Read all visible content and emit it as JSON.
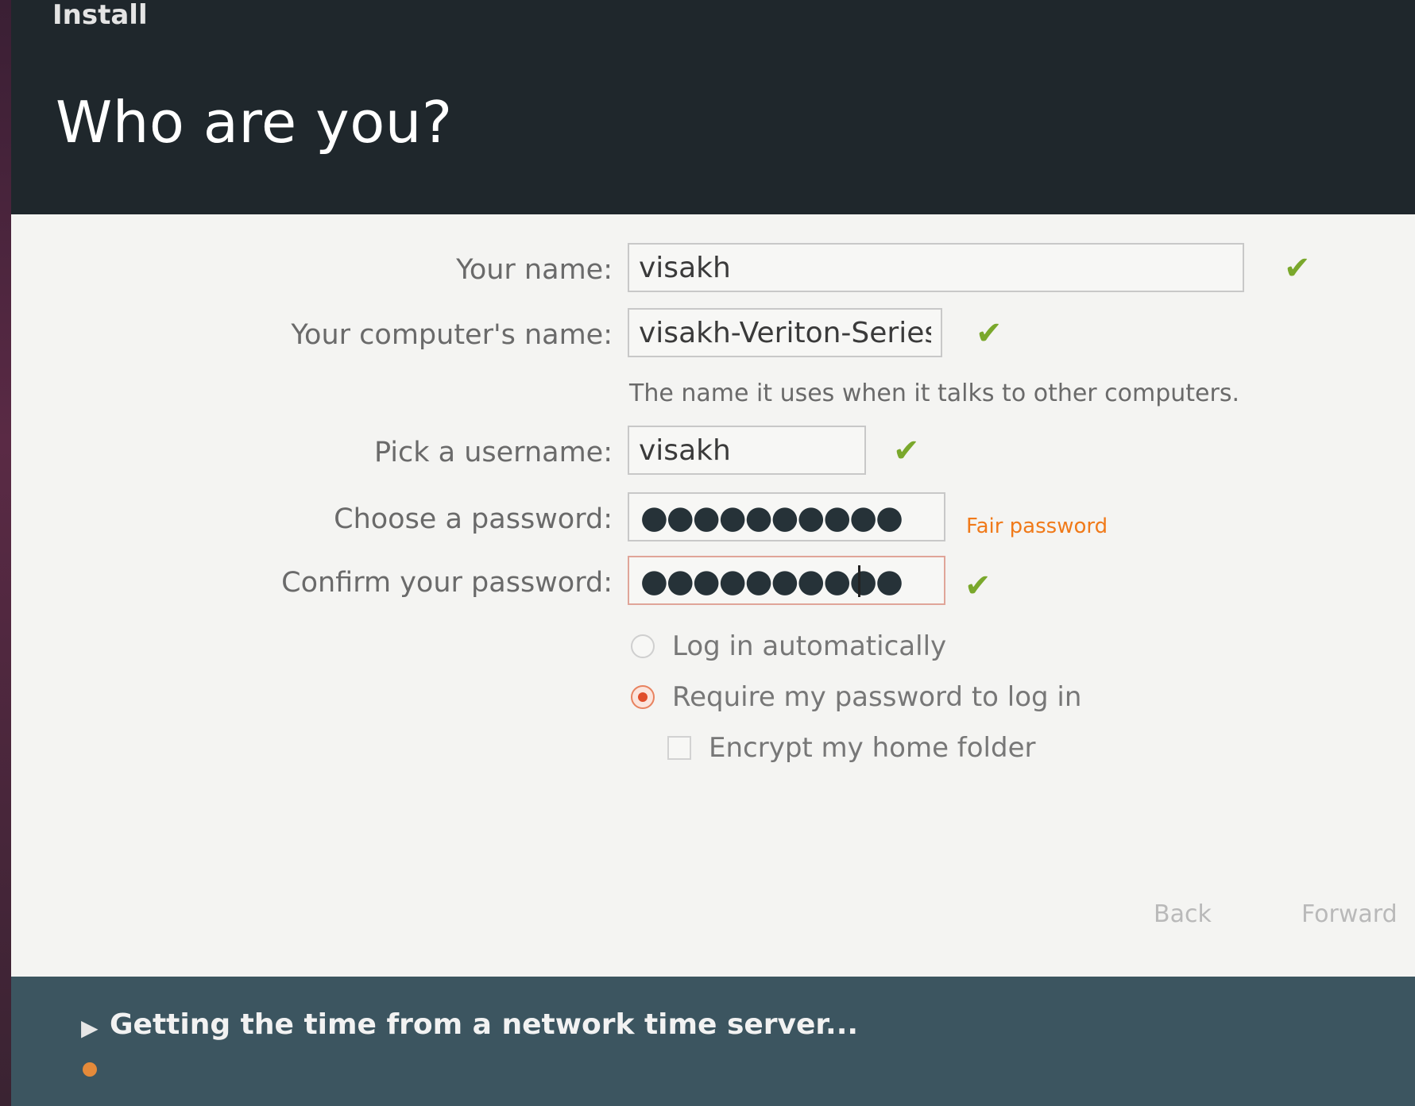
{
  "window": {
    "title": "Install"
  },
  "header": {
    "title": "Who are you?"
  },
  "form": {
    "your_name": {
      "label": "Your name:",
      "value": "visakh"
    },
    "computer_name": {
      "label": "Your computer's name:",
      "value": "visakh-Veriton-Series",
      "hint": "The name it uses when it talks to other computers."
    },
    "username": {
      "label": "Pick a username:",
      "value": "visakh"
    },
    "password": {
      "label": "Choose a password:",
      "masked": "●●●●●●●●●●",
      "strength": "Fair password"
    },
    "confirm_password": {
      "label": "Confirm your password:",
      "masked": "●●●●●●●●●●"
    }
  },
  "options": {
    "log_in_automatically": {
      "label": "Log in automatically",
      "selected": false
    },
    "require_password": {
      "label": "Require my password to log in",
      "selected": true
    },
    "encrypt_home": {
      "label": "Encrypt my home folder",
      "checked": false
    }
  },
  "buttons": {
    "back": "Back",
    "forward": "Forward"
  },
  "status": {
    "message": "Getting the time from a network time server..."
  },
  "colors": {
    "check": "#7aa82c",
    "strength": "#f07a1a",
    "accent": "#e04d2a",
    "header_bg": "#1f272c",
    "statusbar_bg": "#3c5560"
  },
  "icons": {
    "valid": "checkmark-icon",
    "status": "play-arrow-icon"
  }
}
